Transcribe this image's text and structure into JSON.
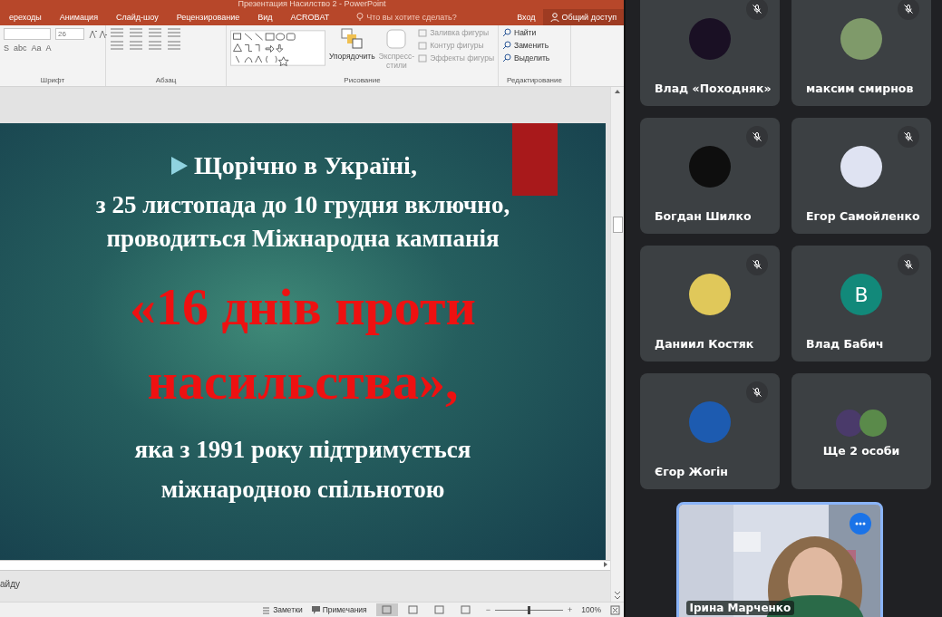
{
  "window": {
    "title": "Презентация Насилство 2 - PowerPoint"
  },
  "ribbon": {
    "tabs": [
      {
        "label": "ереходы",
        "selected": false
      },
      {
        "label": "Анимация",
        "selected": false
      },
      {
        "label": "Слайд-шоу",
        "selected": false
      },
      {
        "label": "Рецензирование",
        "selected": false
      },
      {
        "label": "Вид",
        "selected": false
      },
      {
        "label": "ACROBAT",
        "selected": false
      }
    ],
    "tell_me": "Что вы хотите сделать?",
    "sign_in": "Вход",
    "share": "Общий доступ",
    "font_size": "26",
    "font_buttons": [
      "S",
      "abc",
      "Aa",
      "A"
    ],
    "arrange": "Упорядочить",
    "quick_styles": [
      "Экспресс-",
      "стили"
    ],
    "shape_format": [
      "Заливка фигуры",
      "Контур фигуры",
      "Эффекты фигуры"
    ],
    "editing": [
      "Найти",
      "Заменить",
      "Выделить"
    ],
    "groups": [
      "Шрифт",
      "Абзац",
      "Рисование",
      "Редактирование"
    ]
  },
  "slide": {
    "heading": "Щорічно в Україні,",
    "lines": [
      "з 25 листопада до 10 грудня включно,",
      "проводиться Міжнародна кампанія"
    ],
    "highlight": [
      "«16 днів проти",
      "насильства»,"
    ],
    "closing": [
      "яка з 1991 року підтримується",
      "міжнародною спільнотою"
    ]
  },
  "notes": {
    "text": "айду"
  },
  "status_bar": {
    "notes": "Заметки",
    "comments": "Примечания",
    "views": [
      {
        "selected": true
      },
      {
        "selected": false
      },
      {
        "selected": false
      },
      {
        "selected": false
      }
    ],
    "zoom": {
      "level": 0.5,
      "reading": "100%",
      "minus": "−",
      "plus": "+"
    }
  },
  "meeting": {
    "participants": [
      {
        "name": "Влад «Походняк»",
        "muted": true
      },
      {
        "name": "максим смирнов",
        "muted": true
      },
      {
        "name": "Богдан Шилко",
        "muted": true
      },
      {
        "name": "Егор Самойленко",
        "muted": true
      },
      {
        "name": "Даниил Костяк",
        "muted": true
      },
      {
        "name": "Влад Бабич",
        "muted": true,
        "avatar": {
          "kind": "initial",
          "letter": "B",
          "color": "#12897a"
        }
      },
      {
        "name": "Єгор Жогін",
        "muted": true
      },
      {
        "kind": "others",
        "name": "Ще 2 особи",
        "avatars": [
          {
            "color": "#4a3a6a"
          },
          {
            "color": "#5a8a4a"
          }
        ]
      }
    ],
    "self": {
      "name": "Ірина Марченко"
    }
  }
}
